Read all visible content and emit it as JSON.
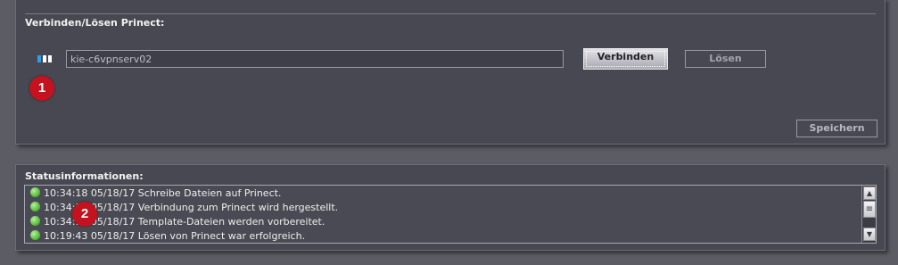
{
  "connect_section": {
    "title": "Verbinden/Lösen Prinect:",
    "host_value": "kie-c6vpnserv02",
    "connect_label": "Verbinden",
    "release_label": "Lösen",
    "save_label": "Speichern",
    "connection_icon": "connection-status-bars-icon"
  },
  "status_section": {
    "title": "Statusinformationen:",
    "status_icon": "green-status-dot-icon",
    "entries": [
      {
        "text": "10:34:18 05/18/17 Schreibe Dateien auf Prinect."
      },
      {
        "text": "10:34:18 05/18/17 Verbindung zum Prinect wird hergestellt."
      },
      {
        "text": "10:34:18 05/18/17 Template-Dateien werden vorbereitet."
      },
      {
        "text": "10:19:43 05/18/17 Lösen von Prinect war erfolgreich."
      }
    ]
  },
  "callouts": [
    "1",
    "2"
  ],
  "colors": {
    "background": "#5c5c64",
    "panel": "#484852",
    "callout": "#c4121f",
    "status_ok": "#4cb52e",
    "accent_bar": "#2ba0e8"
  }
}
